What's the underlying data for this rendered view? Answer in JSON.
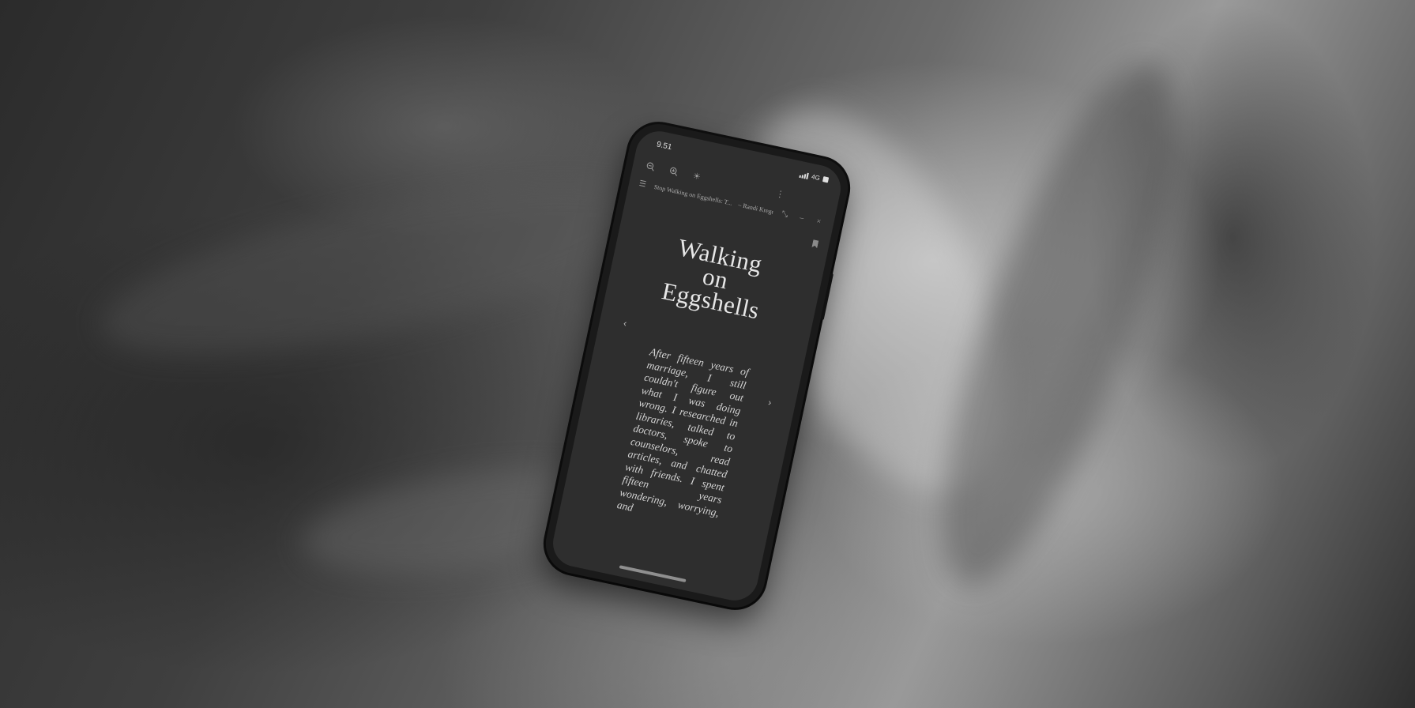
{
  "status_bar": {
    "time": "9.51",
    "network": "4G"
  },
  "toolbar": {
    "zoom_out_icon": "zoom-out-icon",
    "zoom_in_icon": "zoom-in-icon",
    "brightness_icon": "brightness-icon",
    "more_icon": "more-vertical-icon"
  },
  "tabbar": {
    "menu_icon": "menu-icon",
    "title": "Stop Walking on Eggshells: T...",
    "author": "– Randi Kreger",
    "fullscreen_icon": "fullscreen-icon",
    "minimize_icon": "minimize-icon",
    "close_icon": "close-icon"
  },
  "book": {
    "title_lines": [
      "Walking",
      "on",
      "Eggshells"
    ],
    "body": "After fifteen years of marriage, I still couldn't figure out what I was doing wrong. I researched in libraries, talked to doctors, spoke to counselors, read articles, and chatted with friends. I spent fifteen years wondering, worrying, and",
    "prev_label": "‹",
    "next_label": "›"
  },
  "colors": {
    "screen_bg": "#2e2e2e",
    "text": "#e6e6e6",
    "phone_body": "#1a1a1a"
  }
}
